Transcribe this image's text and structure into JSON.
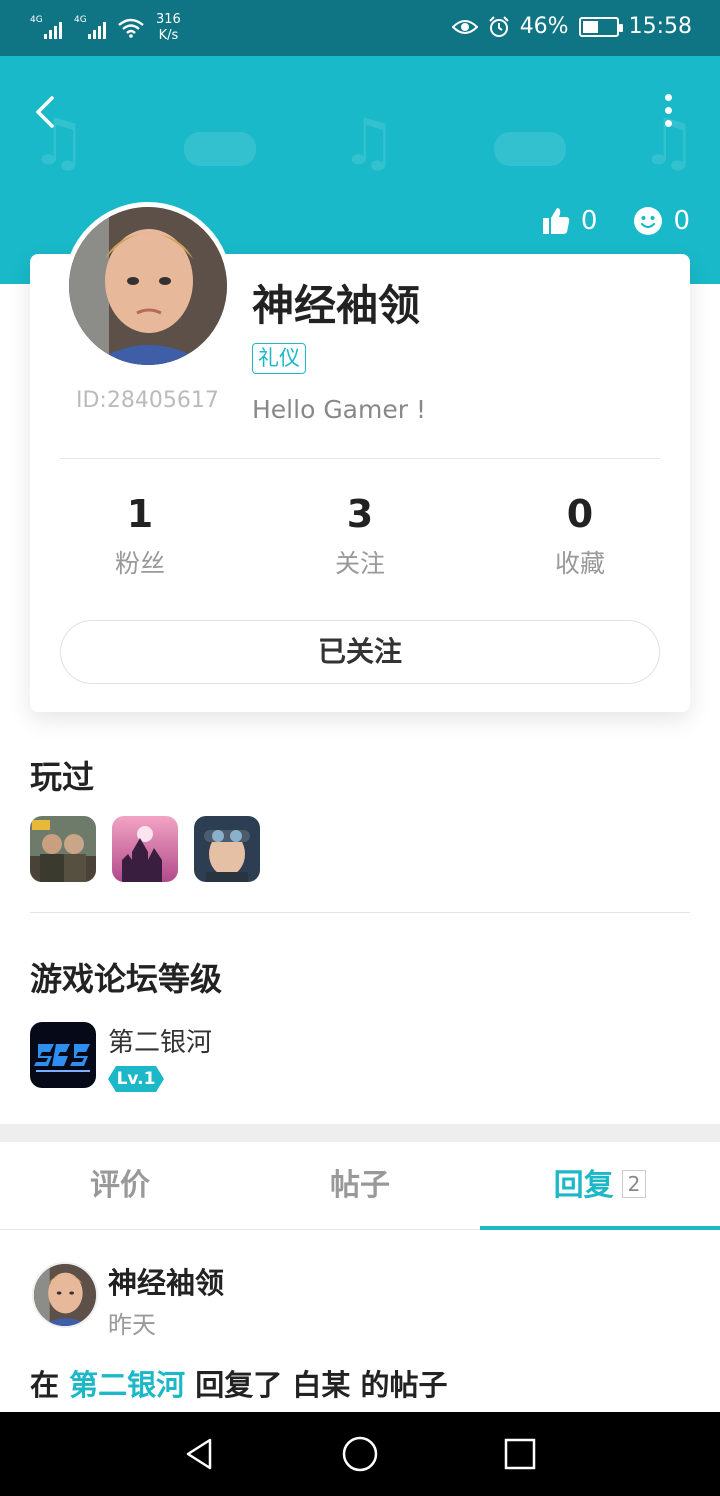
{
  "status_bar": {
    "net1": "4G",
    "net2": "4G",
    "speed_value": "316",
    "speed_unit": "K/s",
    "battery": "46%",
    "time": "15:58"
  },
  "header": {
    "likes": "0",
    "smiles": "0"
  },
  "profile": {
    "nickname": "神经袖领",
    "badge": "礼仪",
    "id_text": "ID:28405617",
    "bio": "Hello Gamer !",
    "counts": [
      {
        "num": "1",
        "label": "粉丝"
      },
      {
        "num": "3",
        "label": "关注"
      },
      {
        "num": "0",
        "label": "收藏"
      }
    ],
    "follow_button": "已关注"
  },
  "played": {
    "title": "玩过"
  },
  "forum": {
    "title": "游戏论坛等级",
    "name": "第二银河",
    "level": "Lv.1"
  },
  "tabs": [
    {
      "label": "评价"
    },
    {
      "label": "帖子"
    },
    {
      "label": "回复",
      "count": "2"
    }
  ],
  "reply": {
    "author": "神经袖领",
    "time": "昨天",
    "prefix": "在",
    "game": "第二银河",
    "mid": "回复了",
    "target": "白某",
    "suffix": "的帖子"
  },
  "colors": {
    "accent": "#1cb8c8",
    "header_bg": "#19b9c9",
    "status_bg": "#0f7483"
  }
}
